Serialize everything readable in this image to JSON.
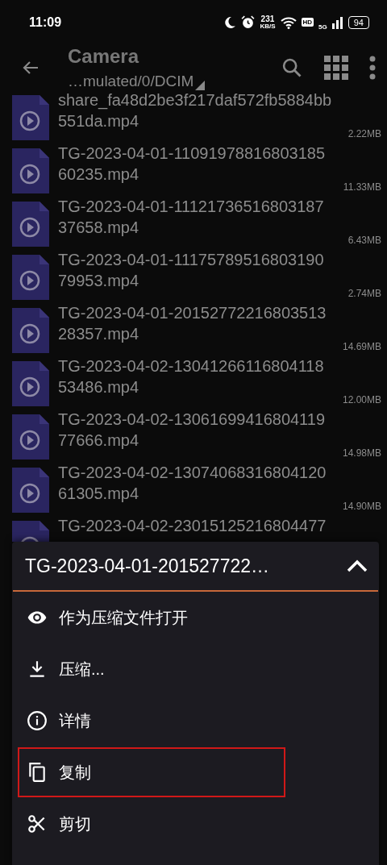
{
  "status_bar": {
    "time": "11:09",
    "net_speed": "231",
    "net_speed_unit": "KB/S",
    "hd_badge": "HD",
    "network_type": "5G",
    "battery": "94"
  },
  "toolbar": {
    "title": "Camera",
    "path": "…mulated/0/DCIM"
  },
  "files": [
    {
      "name": "share_fa48d2be3f217daf572fb5884bb551da.mp4",
      "size": "2.22MB"
    },
    {
      "name": "TG-2023-04-01-1109197881680318560235.mp4",
      "size": "11.33MB"
    },
    {
      "name": "TG-2023-04-01-1112173651680318737658.mp4",
      "size": "6.43MB"
    },
    {
      "name": "TG-2023-04-01-1117578951680319079953.mp4",
      "size": "2.74MB"
    },
    {
      "name": "TG-2023-04-01-2015277221680351328357.mp4",
      "size": "14.69MB"
    },
    {
      "name": "TG-2023-04-02-1304126611680411853486.mp4",
      "size": "12.00MB"
    },
    {
      "name": "TG-2023-04-02-1306169941680411977666.mp4",
      "size": "14.98MB"
    },
    {
      "name": "TG-2023-04-02-1307406831680412061305.mp4",
      "size": "14.90MB"
    },
    {
      "name": "TG-2023-04-02-23015125216804477"
    }
  ],
  "menu": {
    "title": "TG-2023-04-01-201527722…",
    "items": [
      {
        "kind": "eye",
        "label": "作为压缩文件打开",
        "highlighted": false
      },
      {
        "kind": "download",
        "label": "压缩...",
        "highlighted": false
      },
      {
        "kind": "info",
        "label": "详情",
        "highlighted": false
      },
      {
        "kind": "copy",
        "label": "复制",
        "highlighted": true
      },
      {
        "kind": "cut",
        "label": "剪切",
        "highlighted": false
      }
    ]
  }
}
